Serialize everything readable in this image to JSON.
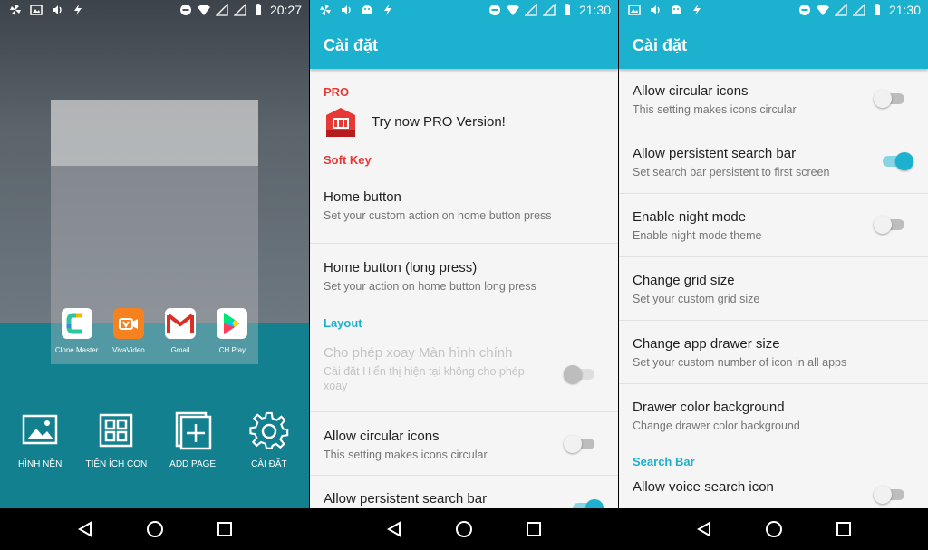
{
  "panel1": {
    "status_time": "20:27",
    "apps": [
      {
        "label": "Clone Master",
        "color": "#ffffff"
      },
      {
        "label": "VivaVideo",
        "color": "#f6811f"
      },
      {
        "label": "Gmail",
        "color": "#ffffff"
      },
      {
        "label": "CH Play",
        "color": "#ffffff"
      }
    ],
    "tools": [
      {
        "label": "HÌNH NỀN",
        "icon": "image-icon"
      },
      {
        "label": "TIỆN ÍCH CON",
        "icon": "widgets-icon"
      },
      {
        "label": "ADD PAGE",
        "icon": "add-page-icon"
      },
      {
        "label": "CÀI ĐẶT",
        "icon": "gear-icon"
      }
    ]
  },
  "panel2": {
    "status_time": "21:30",
    "title": "Cài đặt",
    "pro_header": "PRO",
    "pro_text": "Try now PRO Version!",
    "soft_key_header": "Soft Key",
    "soft_key_items": [
      {
        "title": "Home button",
        "subtitle": "Set your custom action on home button press"
      },
      {
        "title": "Home button (long press)",
        "subtitle": "Set your action on home button long press"
      }
    ],
    "layout_header": "Layout",
    "layout_items": [
      {
        "title": "Cho phép xoay Màn hình chính",
        "subtitle": "Cài đặt Hiển thị hiện tại không cho phép xoay",
        "toggle": "off",
        "disabled": true
      },
      {
        "title": "Allow circular icons",
        "subtitle": "This setting makes icons circular",
        "toggle": "off",
        "disabled": false
      },
      {
        "title": "Allow persistent search bar",
        "subtitle": "",
        "toggle": "on",
        "disabled": false
      }
    ]
  },
  "panel3": {
    "status_time": "21:30",
    "title": "Cài đặt",
    "items": [
      {
        "title": "Allow circular icons",
        "subtitle": "This setting makes icons circular",
        "toggle": "off"
      },
      {
        "title": "Allow persistent search bar",
        "subtitle": "Set search bar persistent to first screen",
        "toggle": "on"
      },
      {
        "title": "Enable night mode",
        "subtitle": "Enable night mode theme",
        "toggle": "off"
      },
      {
        "title": "Change grid size",
        "subtitle": "Set your custom grid size",
        "toggle": "none"
      },
      {
        "title": "Change app drawer size",
        "subtitle": "Set your custom number of icon in all apps",
        "toggle": "none"
      },
      {
        "title": "Drawer color background",
        "subtitle": "Change drawer color background",
        "toggle": "none"
      }
    ],
    "search_bar_header": "Search Bar",
    "search_bar_items": [
      {
        "title": "Allow voice search icon",
        "subtitle": "",
        "toggle": "off"
      }
    ]
  },
  "colors": {
    "accent": "#1cb1cf",
    "pro_red": "#e53935",
    "launcher_teal": "#13808f"
  }
}
